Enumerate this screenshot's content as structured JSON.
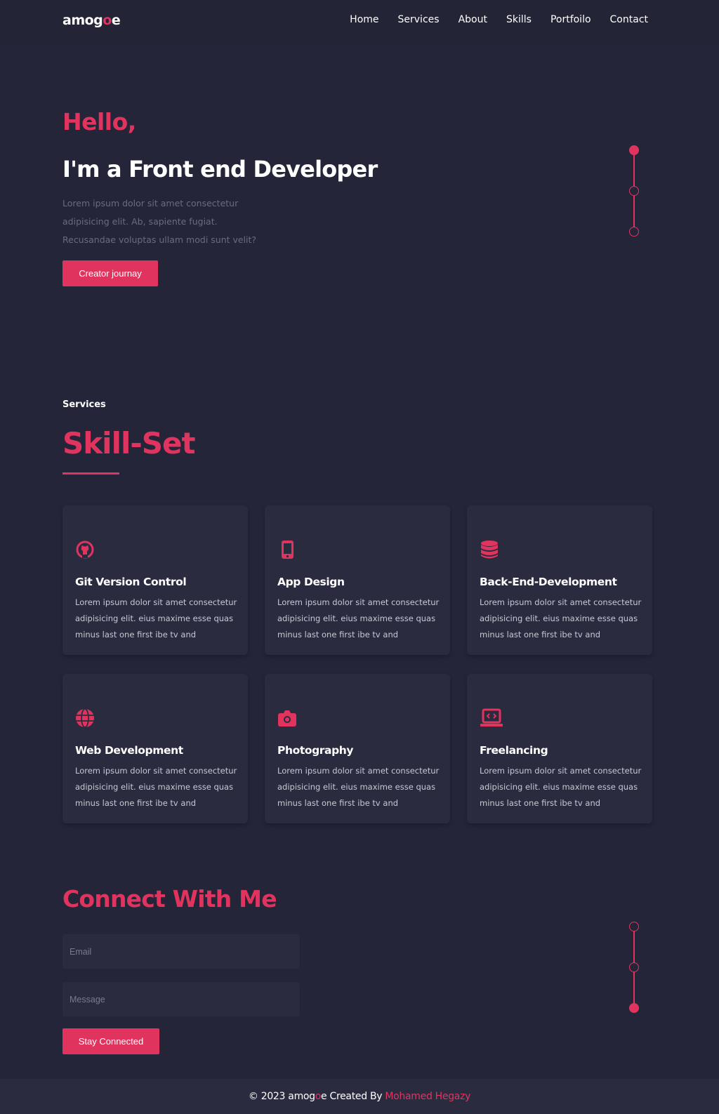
{
  "navbar": {
    "logo_pre": "amog",
    "logo_accent": "o",
    "logo_post": "e",
    "links": [
      "Home",
      "Services",
      "About",
      "Skills",
      "Portfoilo",
      "Contact"
    ]
  },
  "hero": {
    "greeting": "Hello,",
    "title": "I'm a Front end Developer",
    "description": "Lorem ipsum dolor sit amet consectetur adipisicing elit. Ab, sapiente fugiat. Recusandae voluptas ullam modi sunt velit?",
    "button": "Creator journay"
  },
  "services": {
    "label": "Services",
    "title": "Skill-Set",
    "cards": [
      {
        "icon": "github-icon",
        "title": "Git Version Control",
        "text": "Lorem ipsum dolor sit amet consectetur adipisicing elit. eius maxime esse quas minus last one first ibe tv and"
      },
      {
        "icon": "mobile-icon",
        "title": "App Design",
        "text": "Lorem ipsum dolor sit amet consectetur adipisicing elit. eius maxime esse quas minus last one first ibe tv and"
      },
      {
        "icon": "database-icon",
        "title": "Back-End-Development",
        "text": "Lorem ipsum dolor sit amet consectetur adipisicing elit. eius maxime esse quas minus last one first ibe tv and"
      },
      {
        "icon": "globe-icon",
        "title": "Web Development",
        "text": "Lorem ipsum dolor sit amet consectetur adipisicing elit. eius maxime esse quas minus last one first ibe tv and"
      },
      {
        "icon": "camera-icon",
        "title": "Photography",
        "text": "Lorem ipsum dolor sit amet consectetur adipisicing elit. eius maxime esse quas minus last one first ibe tv and"
      },
      {
        "icon": "laptop-code-icon",
        "title": "Freelancing",
        "text": "Lorem ipsum dolor sit amet consectetur adipisicing elit. eius maxime esse quas minus last one first ibe tv and"
      }
    ]
  },
  "contact": {
    "title": "Connect With Me",
    "email_placeholder": "Email",
    "message_placeholder": "Message",
    "button": "Stay Connected"
  },
  "footer": {
    "copyright": "© 2023 amog",
    "logo_accent": "o",
    "logo_post": "e Created By ",
    "author": "Mohamed Hegazy"
  },
  "colors": {
    "accent": "#e0345f",
    "background": "#25253a",
    "card": "#2b2b40"
  }
}
